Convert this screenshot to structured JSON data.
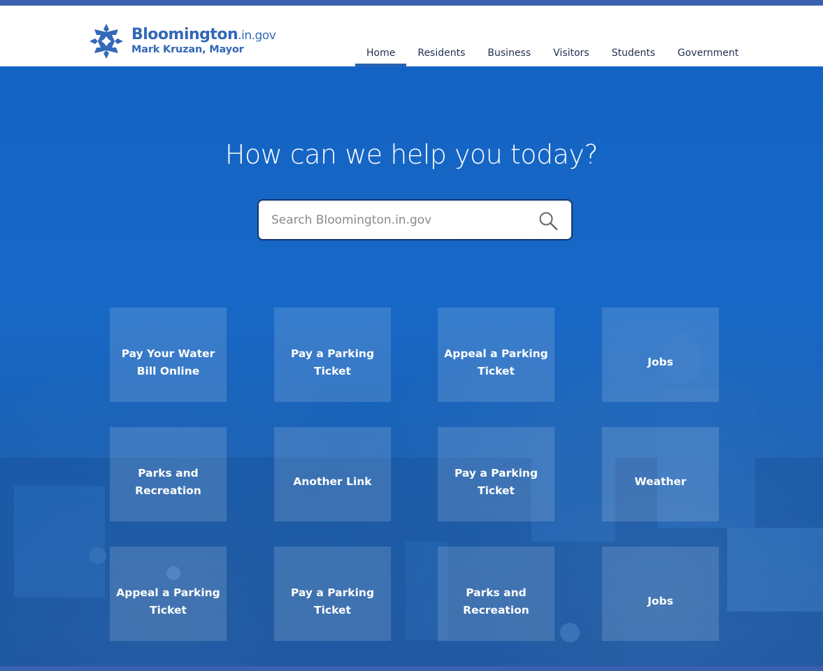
{
  "header": {
    "logo_title": "Bloomington",
    "logo_suffix": ".in.gov",
    "logo_subtitle": "Mark Kruzan, Mayor",
    "nav": [
      "Home",
      "Residents",
      "Business",
      "Visitors",
      "Students",
      "Government"
    ],
    "active_nav": "Home"
  },
  "hero": {
    "title": "How can we help you today?",
    "search_placeholder": "Search Bloomington.in.gov",
    "search_value": ""
  },
  "tiles": [
    "Pay Your Water Bill Online",
    "Pay a Parking Ticket",
    "Appeal a Parking Ticket",
    "Jobs",
    "Parks and Recreation",
    "Another Link",
    "Pay a Parking Ticket",
    "Weather",
    "Appeal a Parking Ticket",
    "Pay a Parking Ticket",
    "Parks and Recreation",
    "Jobs"
  ],
  "colors": {
    "brand_blue": "#3468b8",
    "hero_blue": "#1565c0",
    "stripe": "#3a60b0"
  },
  "icons": {
    "logo": "star-logo-icon",
    "search": "search-icon"
  }
}
